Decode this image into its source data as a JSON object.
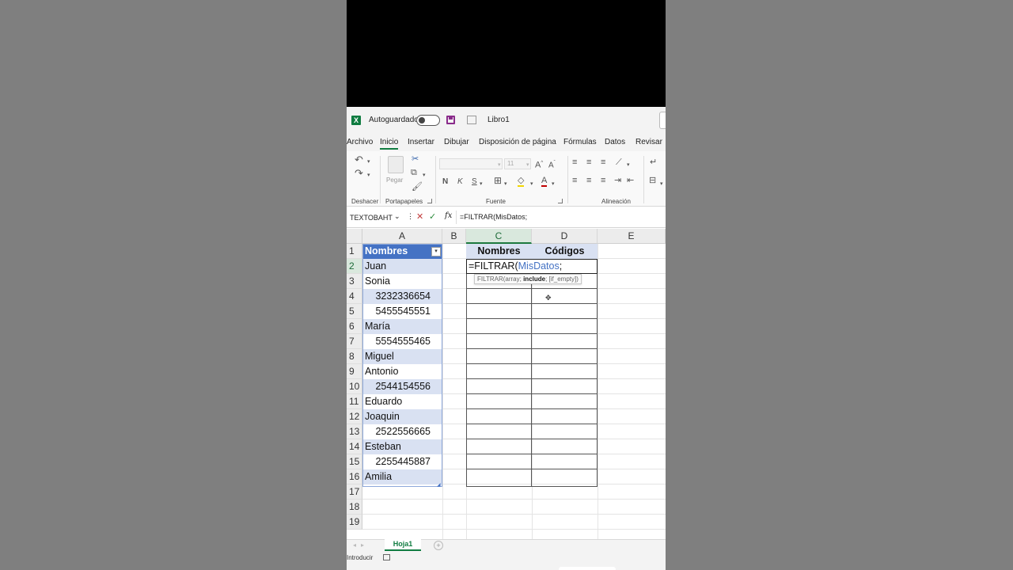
{
  "titlebar": {
    "autosave_label": "Autoguardado",
    "workbook_title": "Libro1"
  },
  "ribbon_tabs": [
    "Archivo",
    "Inicio",
    "Insertar",
    "Dibujar",
    "Disposición de página",
    "Fórmulas",
    "Datos",
    "Revisar"
  ],
  "active_tab": "Inicio",
  "ribbon": {
    "groups": [
      "Deshacer",
      "Portapapeles",
      "Fuente",
      "Alineación"
    ],
    "paste_label": "Pegar",
    "font_size": "11",
    "bold": "N",
    "italic": "K",
    "underline": "S"
  },
  "formula_bar": {
    "name_box": "TEXTOBAHT",
    "fx": "fx",
    "formula": "=FILTRAR(MisDatos;"
  },
  "columns": [
    "A",
    "B",
    "C",
    "D",
    "E"
  ],
  "rows": [
    "1",
    "2",
    "3",
    "4",
    "5",
    "6",
    "7",
    "8",
    "9",
    "10",
    "11",
    "12",
    "13",
    "14",
    "15",
    "16",
    "17",
    "18",
    "19"
  ],
  "table_header": "Nombres",
  "column_a": [
    "Juan",
    "Sonia",
    "3232336654",
    "5455545551",
    "María",
    "5554555465",
    "Miguel",
    "Antonio",
    "2544154556",
    "Eduardo",
    "Joaquin",
    "2522556665",
    "Esteban",
    "2255445887",
    "Amilia"
  ],
  "output_headers": {
    "c": "Nombres",
    "d": "Códigos"
  },
  "active_cell": {
    "prefix": "=FILTRAR(",
    "ref": "MisDatos",
    "suffix": ";"
  },
  "tooltip": {
    "func": "FILTRAR(array; ",
    "arg": "include",
    "rest": "; [if_empty])"
  },
  "sheet_tab": "Hoja1",
  "status": {
    "mode": "Introducir"
  }
}
